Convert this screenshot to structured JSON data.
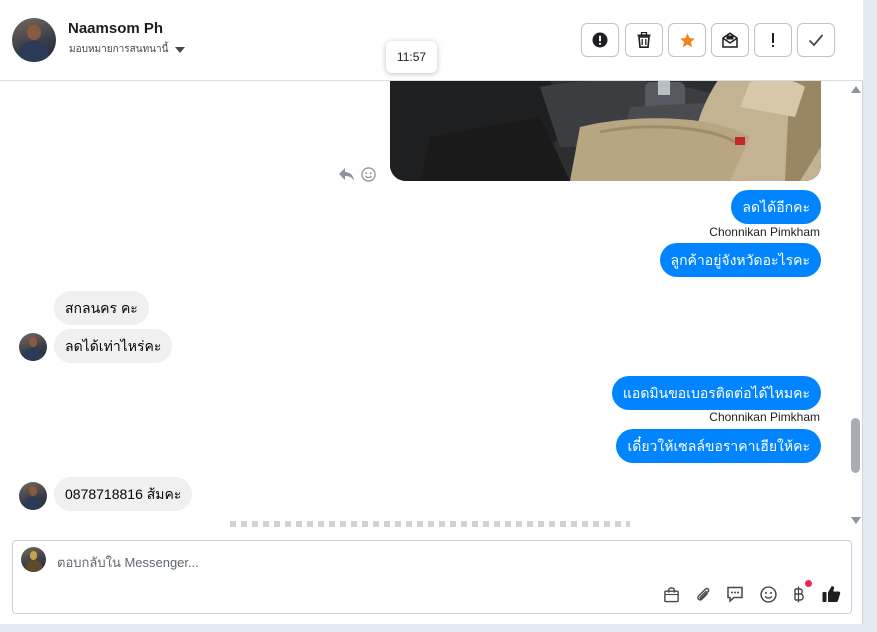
{
  "header": {
    "contact_name": "Naamsom Ph",
    "assign_label": "มอบหมายการสนทนานี้",
    "tooltip_time": "11:57",
    "toolbar": [
      {
        "name": "report-spam-button",
        "icon": "exclamation-circle-icon"
      },
      {
        "name": "delete-button",
        "icon": "trash-icon"
      },
      {
        "name": "star-button",
        "icon": "star-icon"
      },
      {
        "name": "mark-unread-button",
        "icon": "mail-icon"
      },
      {
        "name": "follow-up-button",
        "icon": "exclamation-icon"
      },
      {
        "name": "mark-done-button",
        "icon": "check-icon"
      }
    ]
  },
  "messages": [
    {
      "type": "image",
      "direction": "outgoing",
      "content": "car-interior-photo"
    },
    {
      "type": "text",
      "direction": "outgoing",
      "text": "ลดได้อีกคะ"
    },
    {
      "type": "sender",
      "text": "Chonnikan Pimkham"
    },
    {
      "type": "text",
      "direction": "outgoing",
      "text": "ลูกค้าอยู่จังหวัดอะไรคะ"
    },
    {
      "type": "text",
      "direction": "incoming",
      "text": "สกลนคร คะ"
    },
    {
      "type": "text",
      "direction": "incoming",
      "text": "ลดได้เท่าไหร่คะ"
    },
    {
      "type": "text",
      "direction": "outgoing",
      "text": "แอดมินขอเบอรติดต่อได้ไหมคะ"
    },
    {
      "type": "sender",
      "text": "Chonnikan Pimkham"
    },
    {
      "type": "text",
      "direction": "outgoing",
      "text": "เดี๋ยวให้เซลล์ขอราคาเฮียให้คะ"
    },
    {
      "type": "text",
      "direction": "incoming",
      "text": "0878718816 ส้มคะ"
    }
  ],
  "composer": {
    "placeholder": "ตอบกลับใน Messenger...",
    "icons": [
      "shopping-bag-icon",
      "paperclip-icon",
      "saved-reply-icon",
      "emoji-icon",
      "baht-payment-icon",
      "thumbs-up-icon"
    ]
  },
  "colors": {
    "accent": "#0084ff",
    "incoming_bubble": "#f0f0f0",
    "star": "#f58220",
    "notification_dot": "#f02849"
  }
}
